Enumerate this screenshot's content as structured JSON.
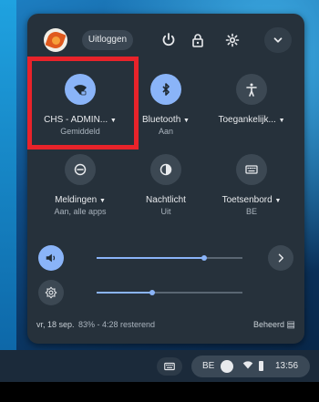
{
  "top": {
    "logout_label": "Uitloggen"
  },
  "tiles": [
    {
      "label": "CHS - ADMIN...",
      "sub": "Gemiddeld",
      "has_dropdown": true,
      "active": true,
      "icon": "wifi-icon"
    },
    {
      "label": "Bluetooth",
      "sub": "Aan",
      "has_dropdown": true,
      "active": true,
      "icon": "bluetooth-icon"
    },
    {
      "label": "Toegankelijk...",
      "sub": "",
      "has_dropdown": true,
      "active": false,
      "icon": "accessibility-icon"
    },
    {
      "label": "Meldingen",
      "sub": "Aan, alle apps",
      "has_dropdown": true,
      "active": false,
      "icon": "notifications-icon"
    },
    {
      "label": "Nachtlicht",
      "sub": "Uit",
      "has_dropdown": false,
      "active": false,
      "icon": "night-light-icon"
    },
    {
      "label": "Toetsenbord",
      "sub": "BE",
      "has_dropdown": true,
      "active": false,
      "icon": "keyboard-icon"
    }
  ],
  "sliders": {
    "volume_level": 0.74,
    "brightness_level": 0.38
  },
  "status": {
    "date": "vr, 18 sep.",
    "battery": "83% - 4:28 resterend",
    "managed": "Beheerd"
  },
  "tray": {
    "ime": "BE",
    "time": "13:56"
  },
  "colors": {
    "accent": "#8ab4f8",
    "panel": "#26313b",
    "highlight": "#e8232a"
  }
}
